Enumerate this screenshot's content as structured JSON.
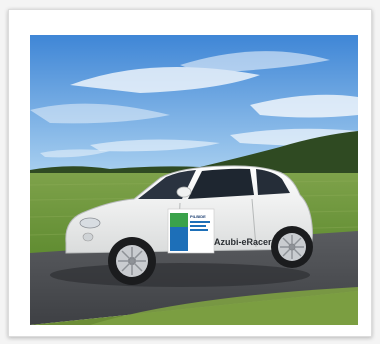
{
  "photo": {
    "car_brand_text": "Azubi-eRacer",
    "sticker_text": "PILBIDE",
    "colors": {
      "sky_top": "#3f86d6",
      "sky_bottom": "#9cc8ee",
      "field": "#6f9a3a",
      "road": "#4a4c50",
      "car_body": "#f4f5f4",
      "sticker_blue": "#1d6fb8",
      "sticker_green": "#3aa24a"
    }
  }
}
